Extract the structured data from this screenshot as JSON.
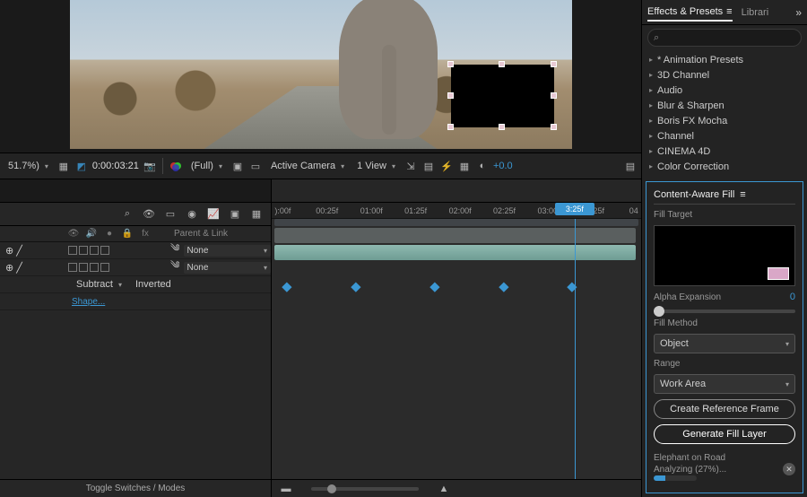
{
  "viewbar": {
    "zoom": "51.7%)",
    "timecode": "0:00:03:21",
    "resolution": "(Full)",
    "camera": "Active Camera",
    "views": "1 View",
    "exposure": "+0.0"
  },
  "timeline": {
    "header_parent": "Parent & Link",
    "none": "None",
    "mode": "Subtract",
    "inverted": "Inverted",
    "shape": "Shape...",
    "toggle": "Toggle Switches / Modes",
    "times": [
      "):00f",
      "00:25f",
      "01:00f",
      "01:25f",
      "02:00f",
      "02:25f",
      "03:00f",
      "03:25f",
      "04"
    ],
    "playhead_label": "3:25f"
  },
  "effects": {
    "tab1": "Effects & Presets",
    "tab2": "Librari",
    "items": [
      "* Animation Presets",
      "3D Channel",
      "Audio",
      "Blur & Sharpen",
      "Boris FX Mocha",
      "Channel",
      "CINEMA 4D",
      "Color Correction"
    ]
  },
  "caf": {
    "title": "Content-Aware Fill",
    "fill_target": "Fill Target",
    "alpha_label": "Alpha Expansion",
    "alpha_value": "0",
    "method_label": "Fill Method",
    "method": "Object",
    "range_label": "Range",
    "range": "Work Area",
    "ref_btn": "Create Reference Frame",
    "gen_btn": "Generate Fill Layer",
    "status1": "Elephant on Road",
    "status2": "Analyzing (27%)..."
  }
}
